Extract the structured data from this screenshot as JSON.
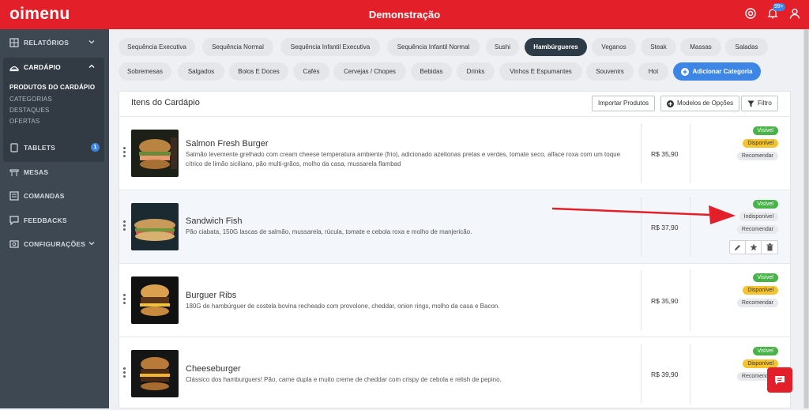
{
  "header": {
    "logo": "oimenu",
    "title": "Demonstração",
    "notification_badge": "99+"
  },
  "sidebar": {
    "relatorios": "RELATÓRIOS",
    "cardapio": "CARDÁPIO",
    "sub": [
      "PRODUTOS DO CARDÁPIO",
      "CATEGORIAS",
      "DESTAQUES",
      "OFERTAS"
    ],
    "tablets": "TABLETS",
    "tablets_badge": "1",
    "mesas": "MESAS",
    "comandas": "COMANDAS",
    "feedbacks": "FEEDBACKS",
    "configuracoes": "CONFIGURAÇÕES"
  },
  "categories": {
    "row1": [
      "Sequência Executiva",
      "Sequência Normal",
      "Sequência Infantil Executiva",
      "Sequência Infantil Normal",
      "Sushi",
      "Hambúrgueres",
      "Veganos",
      "Steak",
      "Massas",
      "Saladas"
    ],
    "row2": [
      "Sobremesas",
      "Salgados",
      "Bolos E Doces",
      "Cafés",
      "Cervejas / Chopes",
      "Bebidas",
      "Drinks",
      "Vinhos E Espumantes",
      "Souvenirs",
      "Hot"
    ],
    "add_label": "Adicionar Categoria",
    "active": "Hambúrgueres"
  },
  "panel": {
    "title": "Itens do Cardápio",
    "import_label": "Importar Produtos",
    "models_label": "Modelos de Opções",
    "filter_label": "Filtro"
  },
  "items": [
    {
      "name": "Salmon Fresh Burger",
      "desc": "Salmão levemente grelhado com cream cheese temperatura ambiente (frio), adicionado azeitonas pretas e verdes, tomate seco, alface roxa com um toque cítrico de limão siciliano, pão multi-grãos, molho da casa, mussarela flambad",
      "price": "R$ 35,90",
      "visible": "Visível",
      "status": "Disponível",
      "recommend": "Recomendar"
    },
    {
      "name": "Sandwich Fish",
      "desc": "Pão ciabata, 150G lascas de salmão, mussarela, rúcula, tomate e cebola roxa e molho de manjericão.",
      "price": "R$ 37,90",
      "visible": "Visível",
      "status": "Indisponível",
      "recommend": "Recomendar"
    },
    {
      "name": "Burguer Ribs",
      "desc": "180G de hambúrguer de costela bovina recheado com provolone, cheddar, onion rings, molho da casa e Bacon.",
      "price": "R$ 35,90",
      "visible": "Visível",
      "status": "Disponível",
      "recommend": "Recomendar"
    },
    {
      "name": "Cheeseburger",
      "desc": "Clássico dos hamburguers! Pão, carne dupla e muito creme de cheddar com crispy de cebola e relish de pepino.",
      "price": "R$ 39,90",
      "visible": "Visível",
      "status": "Disponível",
      "recommend": "Recomendar"
    }
  ],
  "colors": {
    "brand": "#e3202a",
    "sidebar": "#3e4852",
    "accent": "#3d86e6",
    "green": "#49b34a",
    "yellow": "#f4c430"
  }
}
